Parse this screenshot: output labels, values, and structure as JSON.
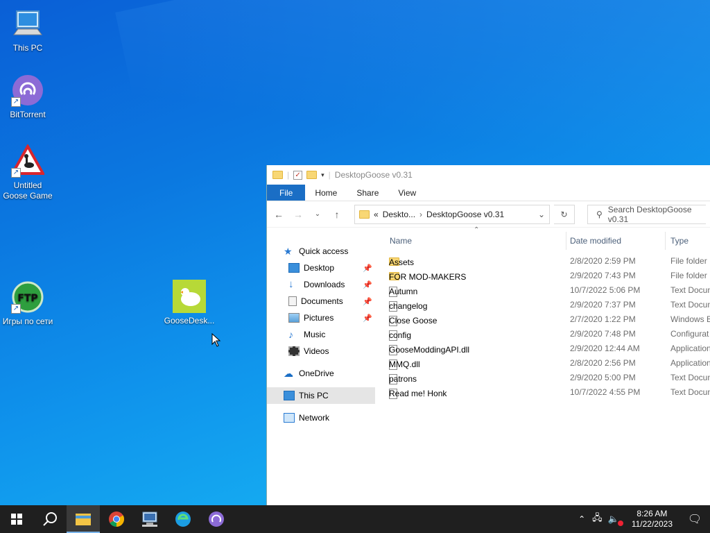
{
  "desktop": {
    "icons": [
      {
        "label": "This PC"
      },
      {
        "label": "BitTorrent"
      },
      {
        "label": "Untitled Goose Game"
      },
      {
        "label": "Игры по сети"
      },
      {
        "label": "GooseDesk..."
      }
    ]
  },
  "explorer": {
    "title": "DesktopGoose v0.31",
    "tabs": [
      "File",
      "Home",
      "Share",
      "View"
    ],
    "address": {
      "prefix": "«",
      "crumb1": "Deskto...",
      "crumb2": "DesktopGoose v0.31"
    },
    "search_placeholder": "Search DesktopGoose v0.31",
    "nav": {
      "quick_access": "Quick access",
      "items": [
        "Desktop",
        "Downloads",
        "Documents",
        "Pictures",
        "Music",
        "Videos"
      ],
      "onedrive": "OneDrive",
      "this_pc": "This PC",
      "network": "Network"
    },
    "columns": {
      "name": "Name",
      "date": "Date modified",
      "type": "Type"
    },
    "files": [
      {
        "name": "Assets",
        "date": "2/8/2020 2:59 PM",
        "type": "File folder"
      },
      {
        "name": "FOR MOD-MAKERS",
        "date": "2/9/2020 7:43 PM",
        "type": "File folder"
      },
      {
        "name": "Autumn",
        "date": "10/7/2022 5:06 PM",
        "type": "Text Docun"
      },
      {
        "name": "changelog",
        "date": "2/9/2020 7:37 PM",
        "type": "Text Docun"
      },
      {
        "name": "Close Goose",
        "date": "2/7/2020 1:22 PM",
        "type": "Windows B"
      },
      {
        "name": "config",
        "date": "2/9/2020 7:48 PM",
        "type": "Configurat"
      },
      {
        "name": "GooseModdingAPI.dll",
        "date": "2/9/2020 12:44 AM",
        "type": "Application"
      },
      {
        "name": "MMQ.dll",
        "date": "2/8/2020 2:56 PM",
        "type": "Application"
      },
      {
        "name": "patrons",
        "date": "2/9/2020 5:00 PM",
        "type": "Text Docun"
      },
      {
        "name": "Read me! Honk",
        "date": "10/7/2022 4:55 PM",
        "type": "Text Docun"
      }
    ]
  },
  "taskbar": {
    "time": "8:26 AM",
    "date": "11/22/2023"
  }
}
